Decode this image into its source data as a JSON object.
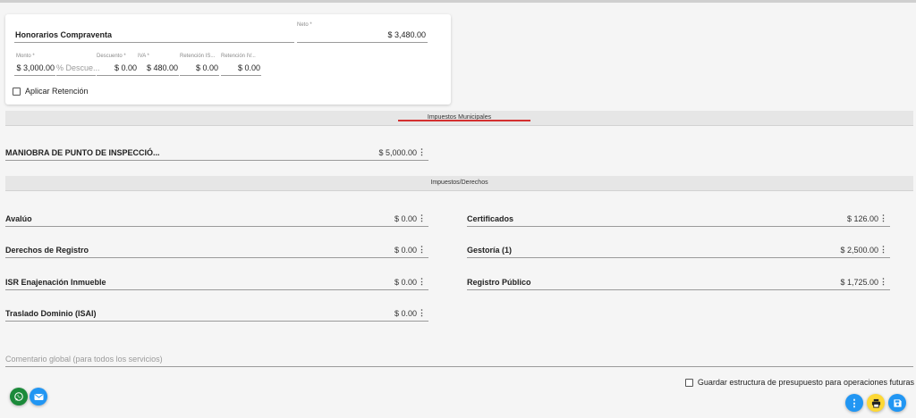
{
  "colors": {
    "whatsapp": "#1b8a3a",
    "mail": "#2196f3",
    "more": "#2196f3",
    "print": "#fdd835",
    "save": "#2196f3",
    "accent_line": "#d32f2f"
  },
  "fee_card": {
    "title": "Honorarios Compraventa",
    "neto_label": "Neto *",
    "neto_value": "$ 3,480.00",
    "fields": [
      {
        "label": "Monto *",
        "value": "$ 3,000.00"
      },
      {
        "label": "",
        "placeholder": "% Descue..."
      },
      {
        "label": "Descuento *",
        "value": "$ 0.00"
      },
      {
        "label": "IVA *",
        "value": "$ 480.00"
      },
      {
        "label": "Retención IS...",
        "value": "$ 0.00"
      },
      {
        "label": "Retención IV...",
        "value": "$ 0.00"
      }
    ],
    "retention_checkbox_label": "Aplicar Retención"
  },
  "municipal": {
    "banner": "Impuestos Municipales",
    "items": [
      {
        "label": "MANIOBRA DE PUNTO DE INSPECCIÓ...",
        "amount": "$ 5,000.00"
      }
    ]
  },
  "rights": {
    "banner": "Impuestos/Derechos",
    "left": [
      {
        "label": "Avalúo",
        "amount": "$ 0.00"
      },
      {
        "label": "Derechos de Registro",
        "amount": "$ 0.00"
      },
      {
        "label": "ISR Enajenación Inmueble",
        "amount": "$ 0.00"
      },
      {
        "label": "Traslado Dominio (ISAI)",
        "amount": "$ 0.00"
      }
    ],
    "right": [
      {
        "label": "Certificados",
        "amount": "$ 126.00"
      },
      {
        "label": "Gestoría (1)",
        "amount": "$ 2,500.00"
      },
      {
        "label": "Registro Público",
        "amount": "$ 1,725.00"
      }
    ]
  },
  "comment_placeholder": "Comentario global (para todos los servicios)",
  "save_structure_label": "Guardar estructura de presupuesto para operaciones futuras",
  "more_glyph": "⋮"
}
